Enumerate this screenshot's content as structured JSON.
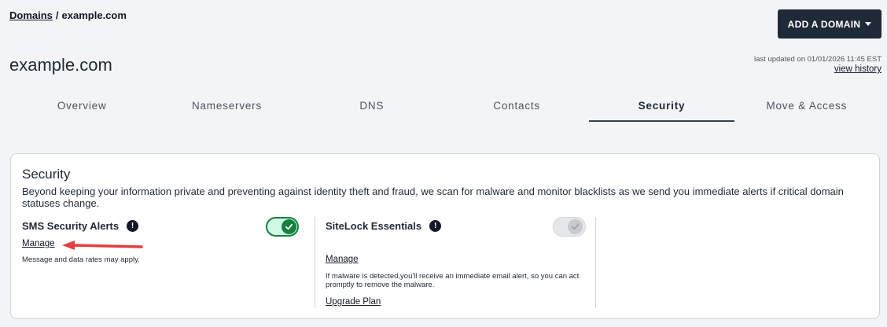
{
  "breadcrumb": {
    "parent": "Domains",
    "separator": "/",
    "current": "example.com"
  },
  "header": {
    "add_domain_label": "ADD A DOMAIN",
    "title": "example.com",
    "last_updated": "last updated on 01/01/2026 11:45 EST",
    "view_history": "view history"
  },
  "tabs": [
    {
      "label": "Overview",
      "active": false
    },
    {
      "label": "Nameservers",
      "active": false
    },
    {
      "label": "DNS",
      "active": false
    },
    {
      "label": "Contacts",
      "active": false
    },
    {
      "label": "Security",
      "active": true
    },
    {
      "label": "Move & Access",
      "active": false
    }
  ],
  "security": {
    "title": "Security",
    "description": "Beyond keeping your information private and preventing against identity theft and fraud, we scan for malware and monitor blacklists as we send you immediate alerts if critical domain statuses change.",
    "sms": {
      "title": "SMS Security Alerts",
      "info_icon": "!",
      "enabled": true,
      "manage": "Manage",
      "note": "Message and data rates may apply."
    },
    "sitelock": {
      "title": "SiteLock Essentials",
      "info_icon": "!",
      "enabled": false,
      "manage": "Manage",
      "note": "If malware is detected,you'll receive an immediate email alert, so you can act promptly to remove the malware.",
      "upgrade": "Upgrade Plan"
    }
  },
  "colors": {
    "primary_dark": "#1f2937",
    "toggle_on": "#15803d",
    "toggle_on_bg": "#d1fae5",
    "annotation_arrow": "#e53e3e"
  },
  "icons": {
    "caret": "caret-down-icon",
    "info": "info-icon",
    "check": "check-icon",
    "arrow": "annotation-arrow-icon"
  }
}
